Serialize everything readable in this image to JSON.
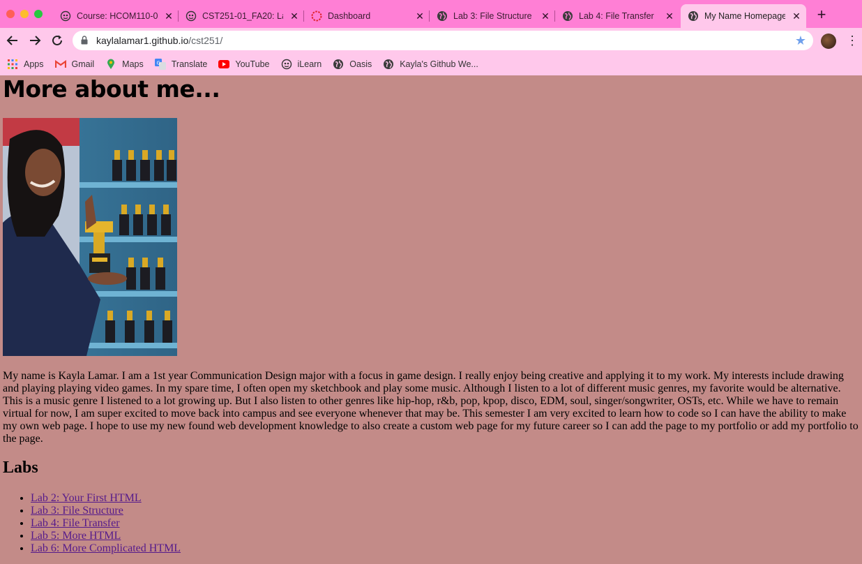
{
  "browser": {
    "tabs": [
      {
        "label": "Course: HCOM110-0",
        "icon": "ilearn-icon",
        "active": false
      },
      {
        "label": "CST251-01_FA20: La",
        "icon": "ilearn-icon",
        "active": false
      },
      {
        "label": "Dashboard",
        "icon": "dashboard-icon",
        "active": false
      },
      {
        "label": "Lab 3: File Structure",
        "icon": "globe-icon",
        "active": false
      },
      {
        "label": "Lab 4: File Transfer",
        "icon": "globe-icon",
        "active": false
      },
      {
        "label": "My Name Homepage",
        "icon": "globe-icon",
        "active": true
      }
    ],
    "close_glyph": "✕",
    "new_tab_glyph": "+",
    "url_host": "kaylalamar1.github.io",
    "url_path": "/cst251/",
    "bookmarks": [
      {
        "label": "Apps",
        "icon": "apps-grid-icon"
      },
      {
        "label": "Gmail",
        "icon": "gmail-icon"
      },
      {
        "label": "Maps",
        "icon": "maps-pin-icon"
      },
      {
        "label": "Translate",
        "icon": "translate-icon"
      },
      {
        "label": "YouTube",
        "icon": "youtube-icon"
      },
      {
        "label": "iLearn",
        "icon": "ilearn-icon"
      },
      {
        "label": "Oasis",
        "icon": "globe-icon"
      },
      {
        "label": "Kayla's Github We...",
        "icon": "globe-icon"
      }
    ],
    "colors": {
      "tab_strip": "#ff7fd5",
      "toolbar": "#ffc8eb",
      "page_bg": "#c38b88",
      "visited_link": "#551a8b"
    }
  },
  "page": {
    "heading": "More about me...",
    "bio": "My name is Kayla Lamar. I am a 1st year Communication Design major with a focus in game design. I really enjoy being creative and applying it to my work. My interests include drawing and playing playing video games. In my spare time, I often open my sketchbook and play some music. Although I listen to a lot of different music genres, my favorite would be alternative. This is a music genre I listened to a lot growing up. But I also listen to other genres like hip-hop, r&b, pop, kpop, disco, EDM, soul, singer/songwriter, OSTs, etc. While we have to remain virtual for now, I am super excited to move back into campus and see everyone whenever that may be. This semester I am very excited to learn how to code so I can have the ability to make my own web page. I hope to use my new found web development knowledge to also create a custom web page for my future career so I can add the page to my portfolio or add my portfolio to the page.",
    "labs_heading": "Labs",
    "labs": [
      "Lab 2: Your First HTML",
      "Lab 3: File Structure",
      "Lab 4: File Transfer",
      "Lab 5: More HTML",
      "Lab 6: More Complicated HTML"
    ]
  }
}
